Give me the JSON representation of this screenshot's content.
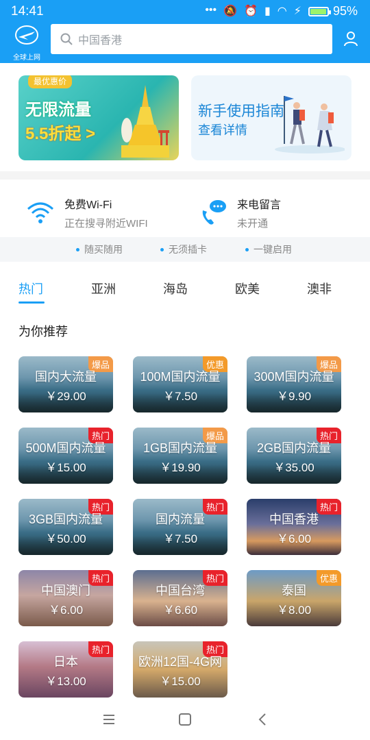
{
  "status": {
    "time": "14:41",
    "battery": "95%",
    "battery_level": 0.95
  },
  "header": {
    "logo_caption": "全球上网",
    "search_placeholder": "中国香港"
  },
  "banners": [
    {
      "tag": "最优惠价",
      "line1": "无限流量",
      "line2": "5.5折起 >"
    },
    {
      "line1": "新手使用指南",
      "line2": "查看详情"
    }
  ],
  "features": [
    {
      "title": "免费Wi-Fi",
      "subtitle": "正在搜寻附近WIFI",
      "icon": "wifi-icon"
    },
    {
      "title": "来电留言",
      "subtitle": "未开通",
      "icon": "voicemail-icon"
    }
  ],
  "hints": [
    "随买随用",
    "无须插卡",
    "一键启用"
  ],
  "tabs": [
    "热门",
    "亚洲",
    "海岛",
    "欧美",
    "澳非"
  ],
  "section_title": "为你推荐",
  "products": [
    {
      "name": "国内大流量",
      "price": "￥29.00",
      "badge": "爆品"
    },
    {
      "name": "100M国内流量",
      "price": "￥7.50",
      "badge": "优惠"
    },
    {
      "name": "300M国内流量",
      "price": "￥9.90",
      "badge": "爆品"
    },
    {
      "name": "500M国内流量",
      "price": "￥15.00",
      "badge": "热门"
    },
    {
      "name": "1GB国内流量",
      "price": "￥19.90",
      "badge": "爆品"
    },
    {
      "name": "2GB国内流量",
      "price": "￥35.00",
      "badge": "热门"
    },
    {
      "name": "3GB国内流量",
      "price": "￥50.00",
      "badge": "热门"
    },
    {
      "name": "国内流量",
      "price": "￥7.50",
      "badge": "热门"
    },
    {
      "name": "中国香港",
      "price": "￥6.00",
      "badge": "热门"
    },
    {
      "name": "中国澳门",
      "price": "￥6.00",
      "badge": "热门"
    },
    {
      "name": "中国台湾",
      "price": "￥6.60",
      "badge": "热门"
    },
    {
      "name": "泰国",
      "price": "￥8.00",
      "badge": "优惠"
    },
    {
      "name": "日本",
      "price": "￥13.00",
      "badge": "热门"
    },
    {
      "name": "欧洲12国-4G网",
      "price": "￥15.00",
      "badge": "热门"
    }
  ],
  "colors": {
    "primary": "#1a9ff5",
    "badge_hot": "#e8222b",
    "badge_burst": "#f39a48",
    "badge_deal": "#f39a2a"
  }
}
